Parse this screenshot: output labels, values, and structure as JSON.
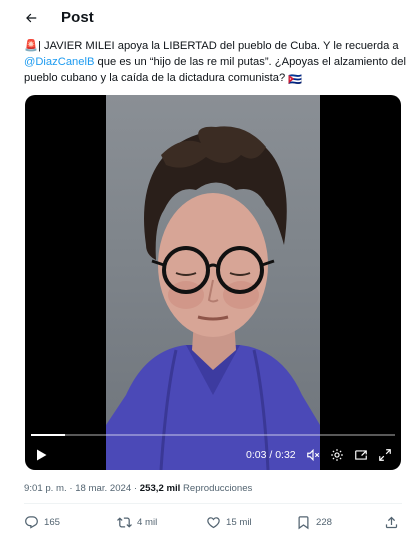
{
  "header": {
    "title": "Post",
    "back_icon": "arrow-left-icon"
  },
  "tweet": {
    "siren": "🚨",
    "text_part1": "| JAVIER MILEI apoya la LIBERTAD del pueblo de Cuba. Y le recuerda a ",
    "mention": "@DiazCanelB",
    "text_part2": " que es un “hijo de las re mil putas”. ¿Apoyas el alzamiento del pueblo cubano y la caída de la dictadura comunista? ",
    "flag": "🇨🇺"
  },
  "video": {
    "time": "0:03 / 0:32",
    "progress_fraction": 0.094,
    "icons": [
      "play-icon",
      "volume-icon",
      "settings-icon",
      "picture-in-picture-icon",
      "fullscreen-icon"
    ]
  },
  "meta": {
    "time": "9:01 p. m.",
    "sep1": "·",
    "date": "18 mar. 2024",
    "sep2": "·",
    "views_count": "253,2 mil",
    "views_label": "Reproducciones"
  },
  "actions": {
    "replies": "165",
    "reposts": "4 mil",
    "likes": "15 mil",
    "bookmarks": "228"
  },
  "colors": {
    "accent": "#1d9bf0",
    "muted": "#536471",
    "text": "#0f1419"
  }
}
